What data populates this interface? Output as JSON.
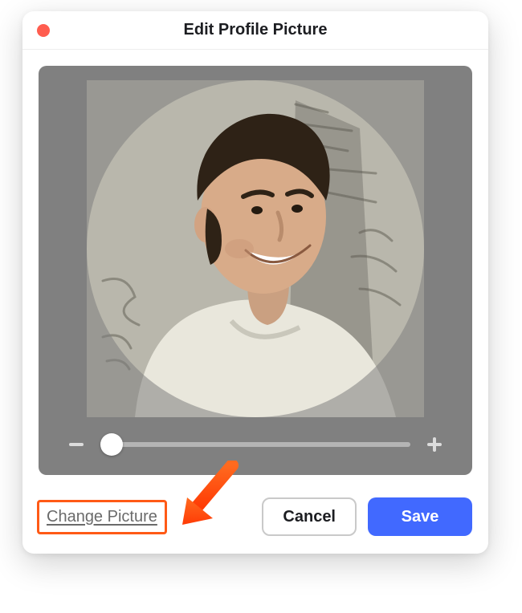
{
  "dialog": {
    "title": "Edit Profile Picture",
    "close_color": "#ff5d4f"
  },
  "actions": {
    "change_picture": "Change Picture",
    "cancel": "Cancel",
    "save": "Save"
  },
  "colors": {
    "primary": "#4169ff",
    "annotation": "#ff5a16",
    "cropper_bg": "#808080"
  },
  "zoom": {
    "value": 0,
    "min": 0,
    "max": 100
  },
  "annotation": {
    "arrow_visible": true,
    "highlight_target": "change-picture-link"
  },
  "photo": {
    "description": "man smiling looking over shoulder in front of whiteboard"
  }
}
